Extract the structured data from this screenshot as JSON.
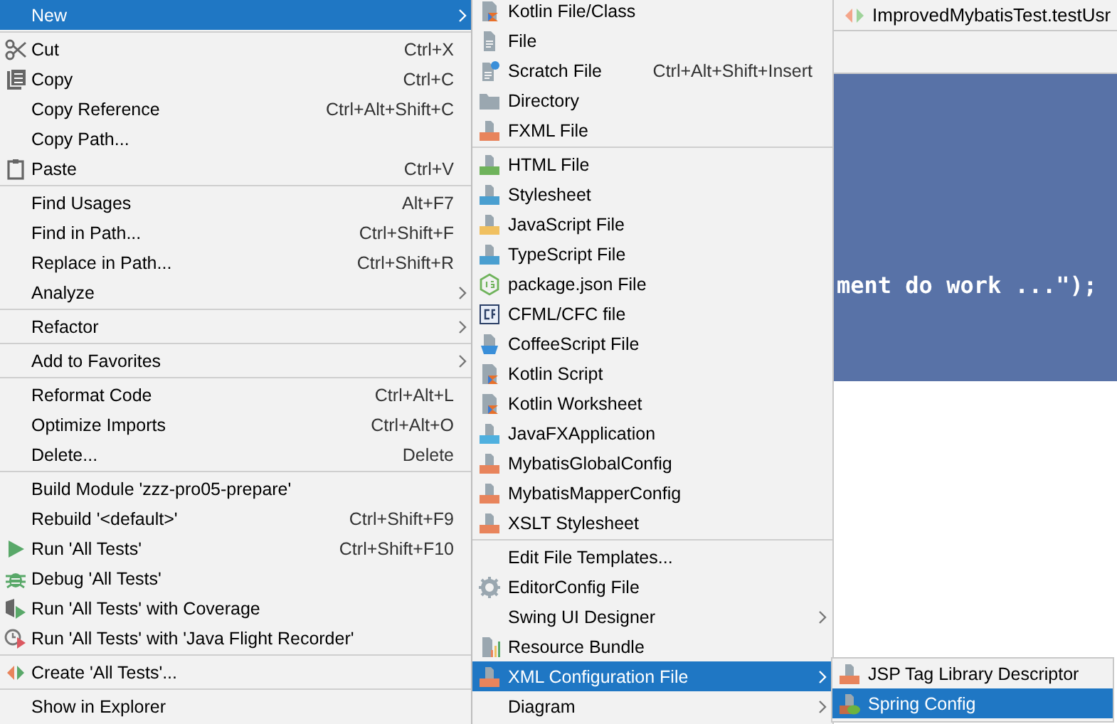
{
  "editor": {
    "tab": {
      "title": "ImprovedMybatisTest.testUsr"
    },
    "code_lines": [
      "ment do work ...\");"
    ]
  },
  "menus": [
    {
      "groups": [
        [
          {
            "label": "New",
            "submenu": true,
            "selected": true
          }
        ],
        [
          {
            "label": "Cut",
            "shortcut": "Ctrl+X",
            "submenu": false,
            "selected": false
          },
          {
            "label": "Copy",
            "shortcut": "Ctrl+C",
            "submenu": false,
            "selected": false
          },
          {
            "label": "Copy Reference",
            "shortcut": "Ctrl+Alt+Shift+C",
            "submenu": false,
            "selected": false
          },
          {
            "label": "Copy Path...",
            "submenu": false,
            "selected": false
          },
          {
            "label": "Paste",
            "shortcut": "Ctrl+V",
            "submenu": false,
            "selected": false
          }
        ],
        [
          {
            "label": "Find Usages",
            "shortcut": "Alt+F7",
            "submenu": false,
            "selected": false
          },
          {
            "label": "Find in Path...",
            "shortcut": "Ctrl+Shift+F",
            "submenu": false,
            "selected": false
          },
          {
            "label": "Replace in Path...",
            "shortcut": "Ctrl+Shift+R",
            "submenu": false,
            "selected": false
          },
          {
            "label": "Analyze",
            "submenu": true,
            "selected": false
          }
        ],
        [
          {
            "label": "Refactor",
            "submenu": true,
            "selected": false
          }
        ],
        [
          {
            "label": "Add to Favorites",
            "submenu": true,
            "selected": false
          }
        ],
        [
          {
            "label": "Reformat Code",
            "shortcut": "Ctrl+Alt+L",
            "submenu": false,
            "selected": false
          },
          {
            "label": "Optimize Imports",
            "shortcut": "Ctrl+Alt+O",
            "submenu": false,
            "selected": false
          },
          {
            "label": "Delete...",
            "shortcut": "Delete",
            "submenu": false,
            "selected": false
          }
        ],
        [
          {
            "label": "Build Module 'zzz-pro05-prepare'",
            "submenu": false,
            "selected": false
          },
          {
            "label": "Rebuild '<default>'",
            "shortcut": "Ctrl+Shift+F9",
            "submenu": false,
            "selected": false
          },
          {
            "label": "Run 'All Tests'",
            "shortcut": "Ctrl+Shift+F10",
            "submenu": false,
            "selected": false
          },
          {
            "label": "Debug 'All Tests'",
            "submenu": false,
            "selected": false
          },
          {
            "label": "Run 'All Tests' with Coverage",
            "submenu": false,
            "selected": false
          },
          {
            "label": "Run 'All Tests' with 'Java Flight Recorder'",
            "submenu": false,
            "selected": false
          }
        ],
        [
          {
            "label": "Create 'All Tests'...",
            "submenu": false,
            "selected": false
          }
        ],
        [
          {
            "label": "Show in Explorer",
            "submenu": false,
            "selected": false
          }
        ]
      ]
    },
    {
      "groups": [
        [
          {
            "label": "Kotlin File/Class",
            "submenu": false,
            "selected": false
          },
          {
            "label": "File",
            "submenu": false,
            "selected": false
          },
          {
            "label": "Scratch File",
            "shortcut": "Ctrl+Alt+Shift+Insert",
            "submenu": false,
            "selected": false
          },
          {
            "label": "Directory",
            "submenu": false,
            "selected": false
          },
          {
            "label": "FXML File",
            "submenu": false,
            "selected": false
          }
        ],
        [
          {
            "label": "HTML File",
            "submenu": false,
            "selected": false
          },
          {
            "label": "Stylesheet",
            "submenu": false,
            "selected": false
          },
          {
            "label": "JavaScript File",
            "submenu": false,
            "selected": false
          },
          {
            "label": "TypeScript File",
            "submenu": false,
            "selected": false
          },
          {
            "label": "package.json File",
            "submenu": false,
            "selected": false
          },
          {
            "label": "CFML/CFC file",
            "submenu": false,
            "selected": false
          },
          {
            "label": "CoffeeScript File",
            "submenu": false,
            "selected": false
          },
          {
            "label": "Kotlin Script",
            "submenu": false,
            "selected": false
          },
          {
            "label": "Kotlin Worksheet",
            "submenu": false,
            "selected": false
          },
          {
            "label": "JavaFXApplication",
            "submenu": false,
            "selected": false
          },
          {
            "label": "MybatisGlobalConfig",
            "submenu": false,
            "selected": false
          },
          {
            "label": "MybatisMapperConfig",
            "submenu": false,
            "selected": false
          },
          {
            "label": "XSLT Stylesheet",
            "submenu": false,
            "selected": false
          }
        ],
        [
          {
            "label": "Edit File Templates...",
            "submenu": false,
            "selected": false
          },
          {
            "label": "EditorConfig File",
            "submenu": false,
            "selected": false
          },
          {
            "label": "Swing UI Designer",
            "submenu": true,
            "selected": false
          },
          {
            "label": "Resource Bundle",
            "submenu": false,
            "selected": false
          },
          {
            "label": "XML Configuration File",
            "submenu": true,
            "selected": true
          },
          {
            "label": "Diagram",
            "submenu": true,
            "selected": false
          }
        ]
      ]
    },
    {
      "groups": [
        [
          {
            "label": "JSP Tag Library Descriptor",
            "submenu": false,
            "selected": false
          },
          {
            "label": "Spring Config",
            "submenu": false,
            "selected": true
          }
        ]
      ]
    }
  ]
}
